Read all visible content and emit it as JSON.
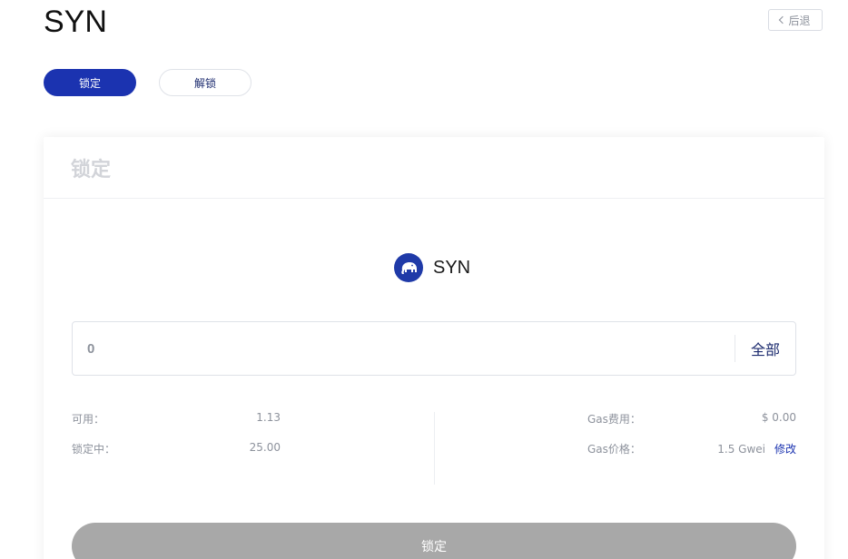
{
  "header": {
    "title": "SYN",
    "back_label": "后退"
  },
  "tabs": [
    {
      "label": "锁定",
      "active": true
    },
    {
      "label": "解锁",
      "active": false
    }
  ],
  "card": {
    "title": "锁定",
    "token": {
      "name": "SYN",
      "icon": "elephant-icon"
    },
    "amount": {
      "value": "",
      "placeholder": "0",
      "max_label": "全部"
    },
    "info_left": [
      {
        "label": "可用：",
        "value": "1.13"
      },
      {
        "label": "锁定中：",
        "value": "25.00"
      }
    ],
    "info_right": [
      {
        "label": "Gas费用：",
        "value": "$ 0.00"
      },
      {
        "label": "Gas价格：",
        "value": "1.5 Gwei",
        "action": "修改"
      }
    ],
    "submit_label": "锁定"
  },
  "colors": {
    "accent": "#1b33b0",
    "button_disabled": "#a8a8a8",
    "muted_text": "#8d929c"
  }
}
